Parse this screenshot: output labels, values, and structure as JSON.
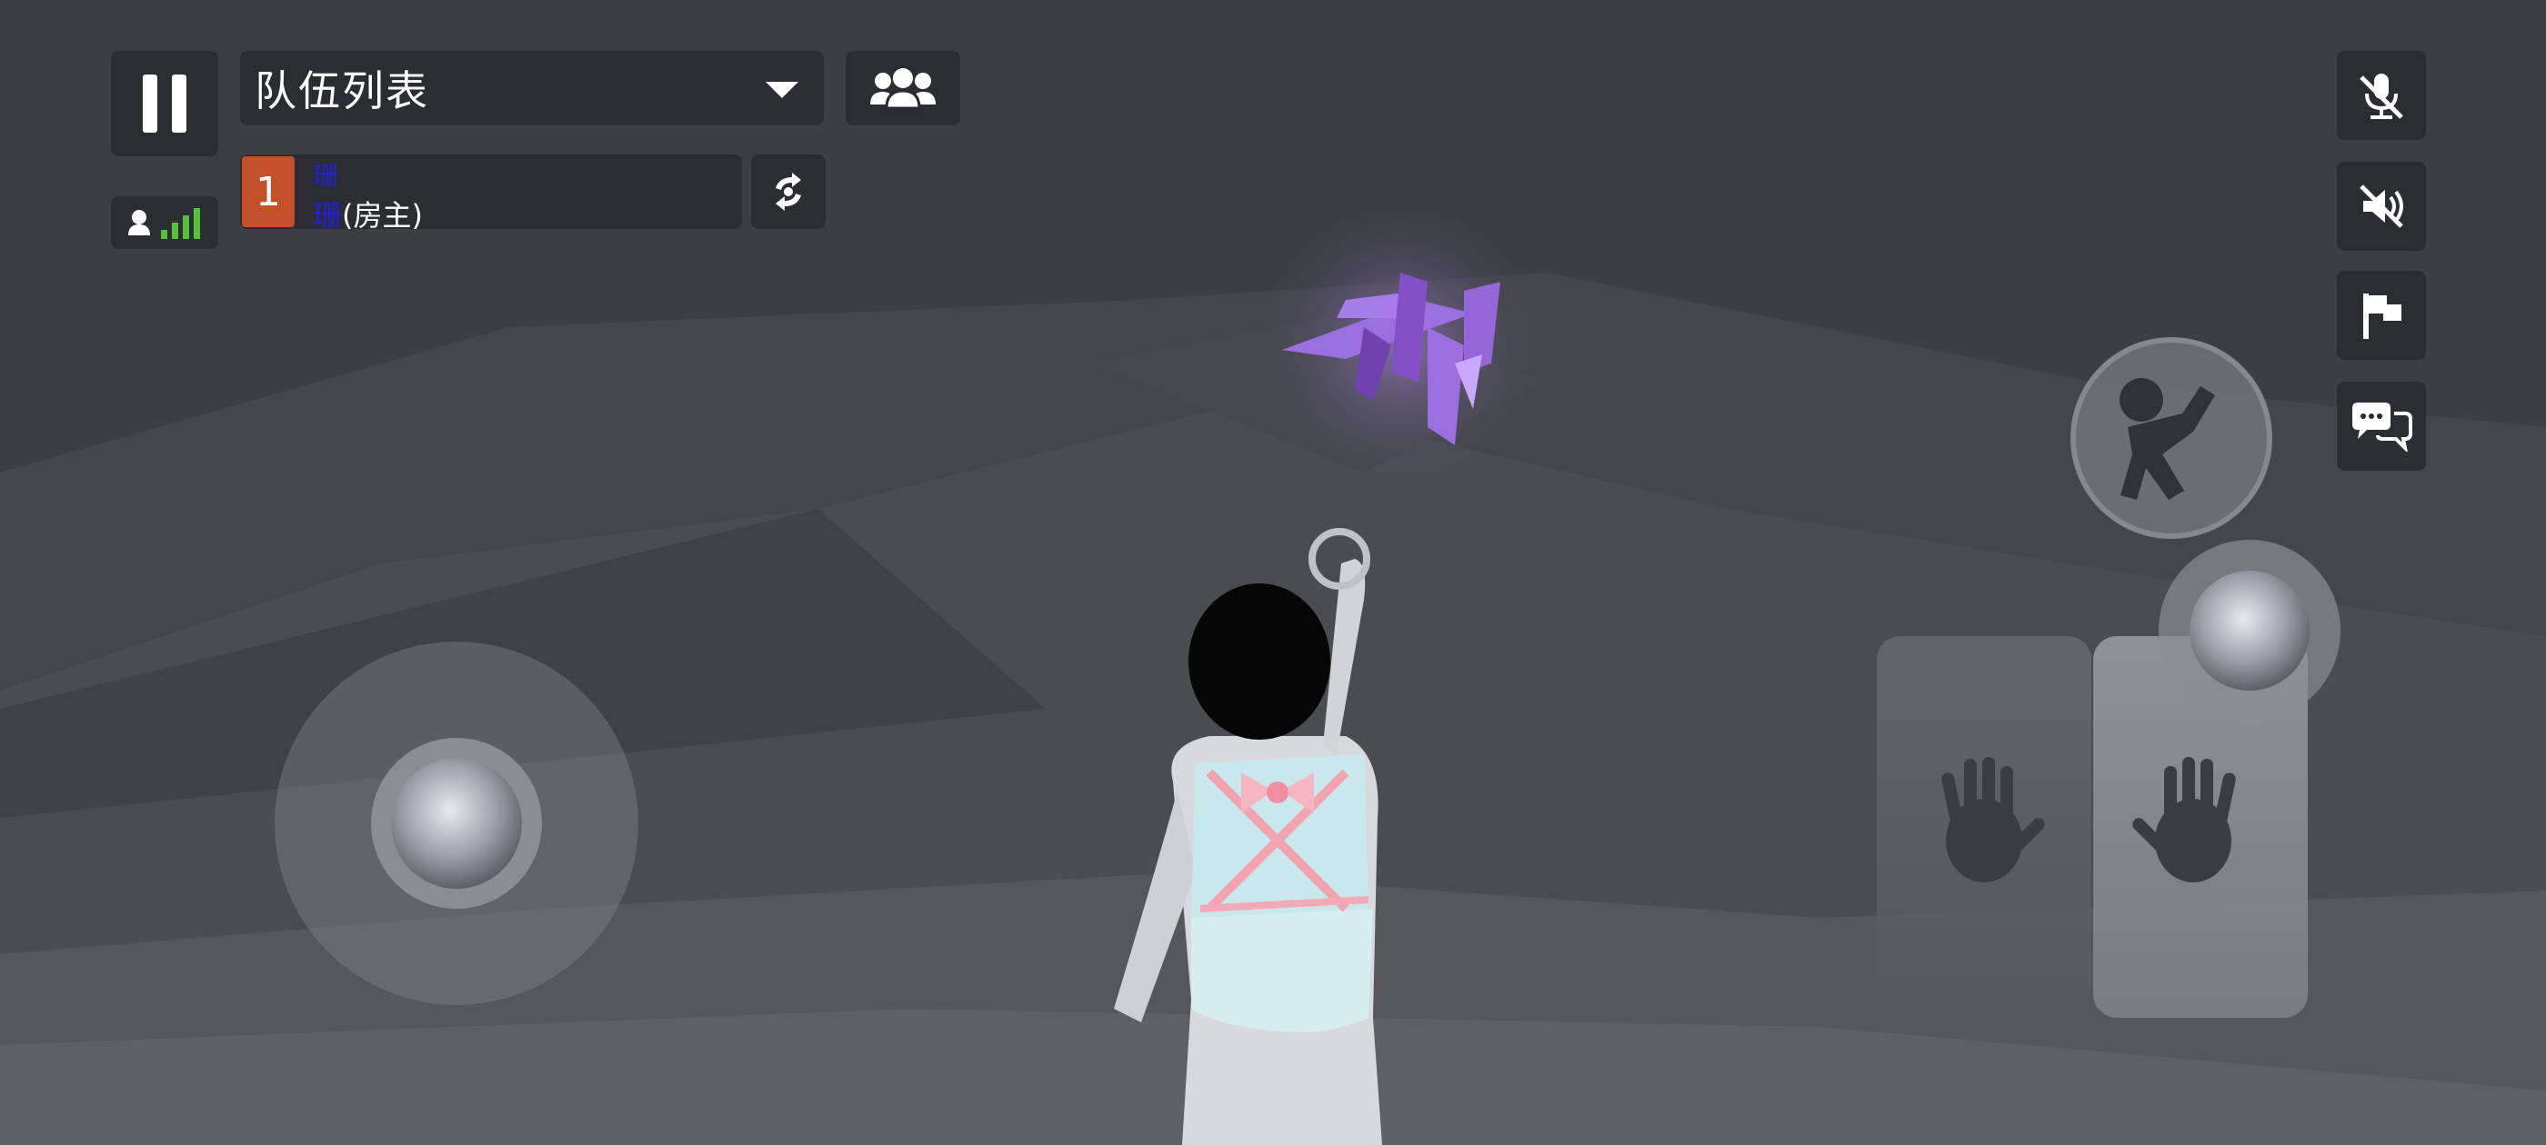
{
  "hud": {
    "team_dropdown": {
      "title": "队伍列表"
    },
    "player_list": [
      {
        "rank": "1",
        "name_line1": "珊",
        "name_line2_blue": "珊",
        "name_line2_suffix": "(房主)"
      }
    ]
  },
  "icons": {
    "pause": "pause-icon",
    "signal": "signal-strength-icon",
    "team_members": "team-members-icon",
    "swap": "swap-icon",
    "mute_mic": "mic-muted-icon",
    "mute_voice": "voice-muted-icon",
    "flag": "flag-icon",
    "chat": "chat-icon",
    "jump": "jump-icon",
    "left_hand": "left-hand-icon",
    "right_hand": "right-hand-icon"
  },
  "colors": {
    "rank_badge": "#c4502a",
    "player_name": "#1f1fe0",
    "signal_bars": "#56c23c",
    "crystal": "#8f5bd6"
  }
}
